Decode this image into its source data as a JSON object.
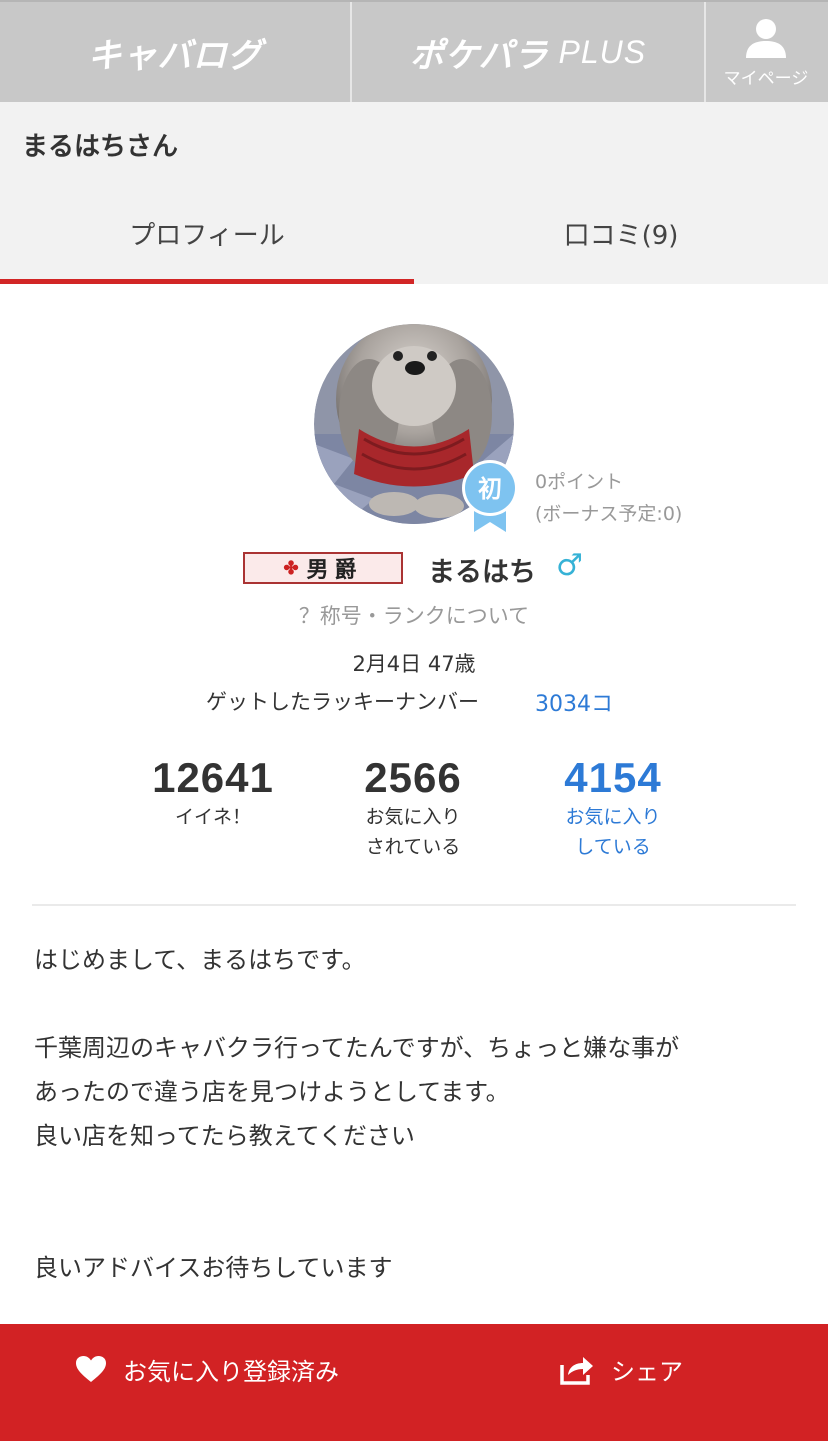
{
  "header": {
    "kyabalog_logo": "キャバログ",
    "pokepara_logo": "ポケパラ",
    "pokepara_plus": "PLUS",
    "mypage_label": "マイページ"
  },
  "page_title": "まるはちさん",
  "tabs": [
    {
      "label": "プロフィール",
      "active": true
    },
    {
      "label": "口コミ(9)",
      "active": false
    }
  ],
  "profile": {
    "badge_label": "初",
    "points": "0ポイント",
    "bonus": "(ボーナス予定:0)",
    "rank_title": "男爵",
    "username": "まるはち",
    "gender_symbol": "♂",
    "rank_link": "？称号・ランクについて",
    "birthday": "2月4日 47歳",
    "lucky_label": "ゲットしたラッキーナンバー",
    "lucky_value": "3034コ"
  },
  "stats": [
    {
      "value": "12641",
      "label_line1": "イイネ！",
      "label_line2": ""
    },
    {
      "value": "2566",
      "label_line1": "お気に入り",
      "label_line2": "されている"
    },
    {
      "value": "4154",
      "label_line1": "お気に入り",
      "label_line2": "している"
    }
  ],
  "bio": "はじめまして、まるはちです。\n\n千葉周辺のキャバクラ行ってたんですが、ちょっと嫌な事が\nあったので違う店を見つけようとしてます。\n良い店を知ってたら教えてください\n\n\n良いアドバイスお待ちしています",
  "bottom_bar": {
    "favorite_label": "お気に入り登録済み",
    "share_label": "シェア"
  },
  "colors": {
    "accent_red": "#d22224",
    "link_blue": "#2d7ad6",
    "gender_blue": "#36b2d6",
    "badge_blue": "#7ec3f0"
  }
}
